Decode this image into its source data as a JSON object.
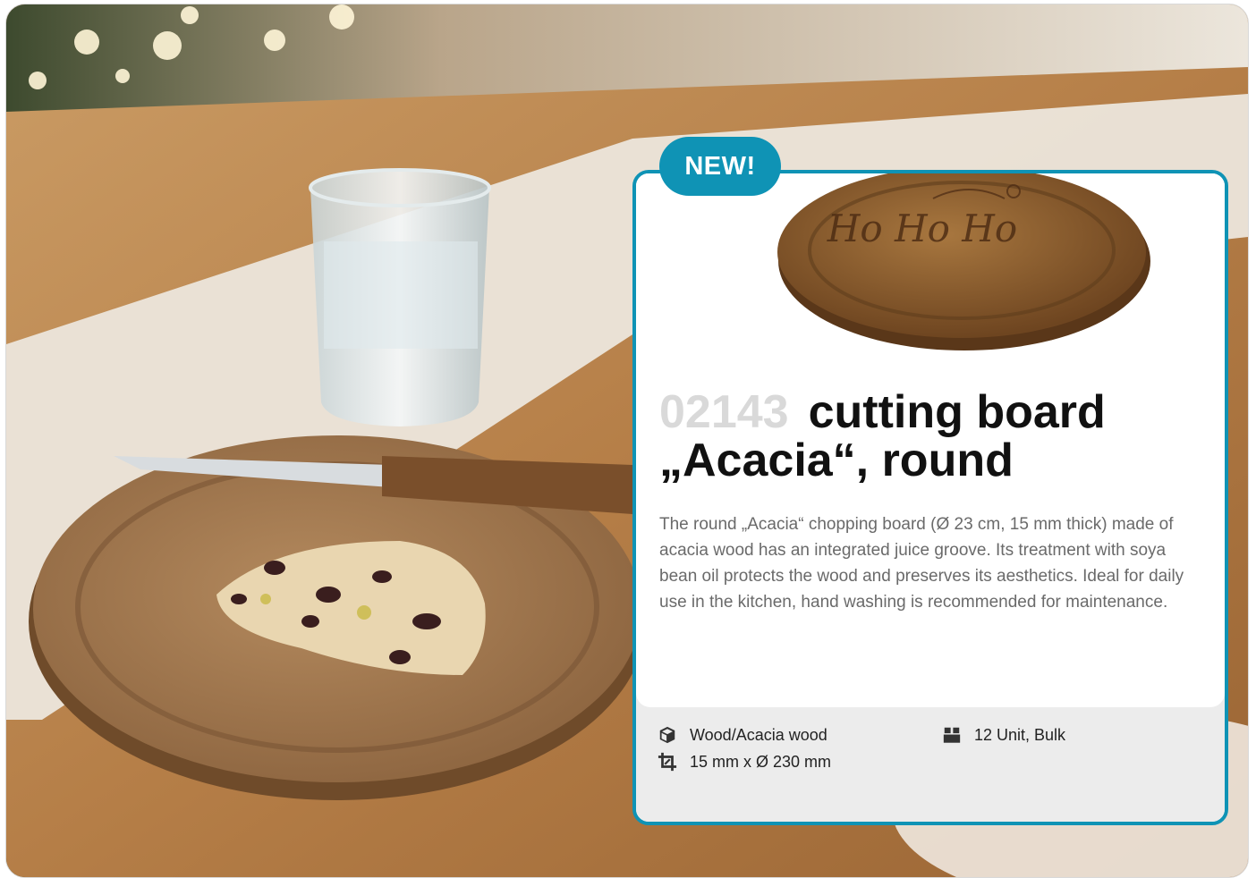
{
  "badge": "NEW!",
  "product": {
    "number": "02143",
    "title_line1": "cutting board",
    "title_line2": "„Acacia“, round",
    "engraving_text": "Ho Ho Ho",
    "description": "The round „Acacia“ chopping board (Ø 23 cm, 15 mm thick) made of acacia wood has an integrated juice groove. Its treat­ment with soya bean oil protects the wood and preserves its aesthetics. Ideal for daily use in the kitchen, hand washing is recommended for maintenance."
  },
  "specs": {
    "material": {
      "icon": "box-icon",
      "label": "Wood/Acacia wood"
    },
    "dimensions": {
      "icon": "crop-icon",
      "label": "15 mm x Ø 230 mm"
    },
    "packaging": {
      "icon": "package-icon",
      "label": "12 Unit, Bulk"
    }
  },
  "colors": {
    "accent": "#0f93b5",
    "title": "#111111",
    "number": "#d9d9d9",
    "description": "#6a6a6a",
    "specs_background": "#ececec"
  }
}
